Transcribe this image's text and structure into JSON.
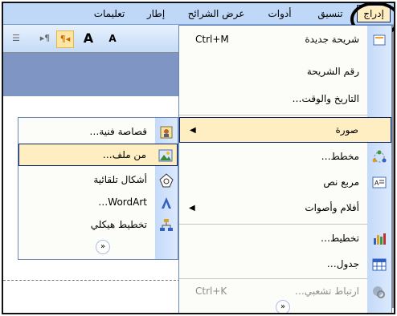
{
  "menubar": {
    "items": [
      {
        "label": "إدراج",
        "active": true
      },
      {
        "label": "تنسيق",
        "active": false
      },
      {
        "label": "أدوات",
        "active": false
      },
      {
        "label": "عرض الشرائح",
        "active": false
      },
      {
        "label": "إطار",
        "active": false
      },
      {
        "label": "تعليمات",
        "active": false
      }
    ]
  },
  "toolbar": {
    "a_big": "A",
    "a_small": "A"
  },
  "insert_menu": {
    "items": [
      {
        "label": "شريحة جديدة",
        "shortcut": "Ctrl+M",
        "icon": "new-slide-icon"
      },
      {
        "label": "رقم الشريحة",
        "shortcut": "",
        "icon": ""
      },
      {
        "label": "التاريخ والوقت…",
        "shortcut": "",
        "icon": ""
      },
      {
        "label": "صورة",
        "shortcut": "",
        "icon": "",
        "submenu": true,
        "selected": true
      },
      {
        "label": "مخطط…",
        "shortcut": "",
        "icon": "diagram-icon"
      },
      {
        "label": "مربع نص",
        "shortcut": "",
        "icon": "text-box-icon"
      },
      {
        "label": "أفلام وأصوات",
        "shortcut": "",
        "icon": "",
        "submenu": true
      },
      {
        "label": "تخطيط…",
        "shortcut": "",
        "icon": "chart-icon"
      },
      {
        "label": "جدول…",
        "shortcut": "",
        "icon": "table-icon"
      },
      {
        "label": "ارتباط تشعبي…",
        "shortcut": "Ctrl+K",
        "icon": "hyperlink-icon",
        "disabled": true
      }
    ],
    "expand": "»"
  },
  "picture_submenu": {
    "items": [
      {
        "label": "قصاصة فنية…",
        "icon": "clip-art-icon"
      },
      {
        "label": "من ملف…",
        "icon": "from-file-icon",
        "selected": true
      },
      {
        "label": "أشكال تلقائية",
        "icon": "autoshapes-icon"
      },
      {
        "label": "WordArt…",
        "icon": "wordart-icon"
      },
      {
        "label": "تخطيط هيكلي",
        "icon": "org-chart-icon"
      }
    ],
    "expand": "»"
  },
  "colors": {
    "highlight": "#ffeec2",
    "menubar": "#c0d8f8",
    "gutter": "#c4dafa"
  }
}
